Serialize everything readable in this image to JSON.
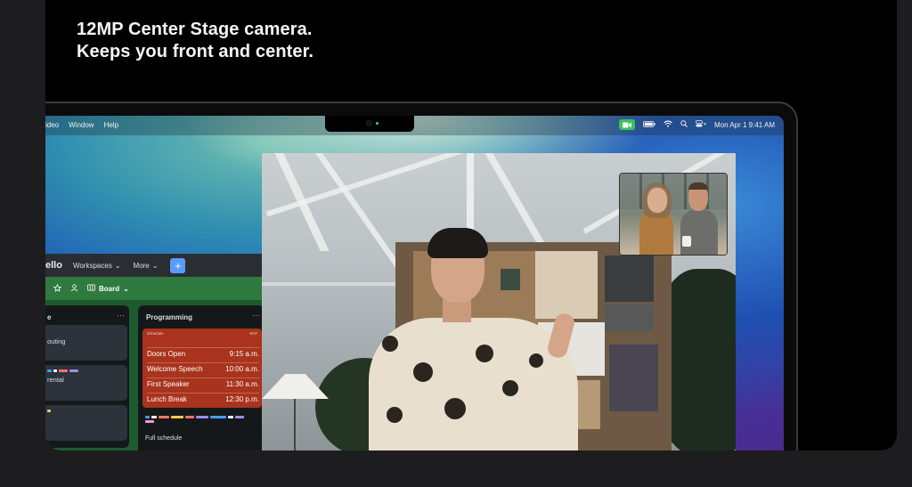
{
  "headline": {
    "line1": "12MP Center Stage camera.",
    "line2": "Keeps you front and center."
  },
  "menubar": {
    "left_items": [
      "ideo",
      "Window",
      "Help"
    ],
    "datetime": "Mon Apr 1  9:41 AM"
  },
  "trello": {
    "logo": "ello",
    "nav": [
      {
        "label": "Workspaces"
      },
      {
        "label": "More"
      }
    ],
    "add_label": "+",
    "board_label": "Board",
    "columns": [
      {
        "title": "e",
        "cards": [
          "outing",
          "rental",
          ""
        ]
      },
      {
        "title": "Programming",
        "schedule": {
          "header_left": "Schedule",
          "header_right": "NAT",
          "rows": [
            {
              "event": "Doors Open",
              "time": "9:15 a.m."
            },
            {
              "event": "Welcome Speech",
              "time": "10:00 a.m."
            },
            {
              "event": "First Speaker",
              "time": "11:30 a.m."
            },
            {
              "event": "Lunch Break",
              "time": "12:30 p.m."
            }
          ]
        },
        "footer": "Full schedule"
      }
    ]
  },
  "colors": {
    "page_bg": "#1d1d1f",
    "card_bg": "#000000",
    "headline": "#f5f5f7",
    "camera_active": "#3cc35b",
    "schedule_card": "#a9331c",
    "trello_blue": "#579dff"
  }
}
